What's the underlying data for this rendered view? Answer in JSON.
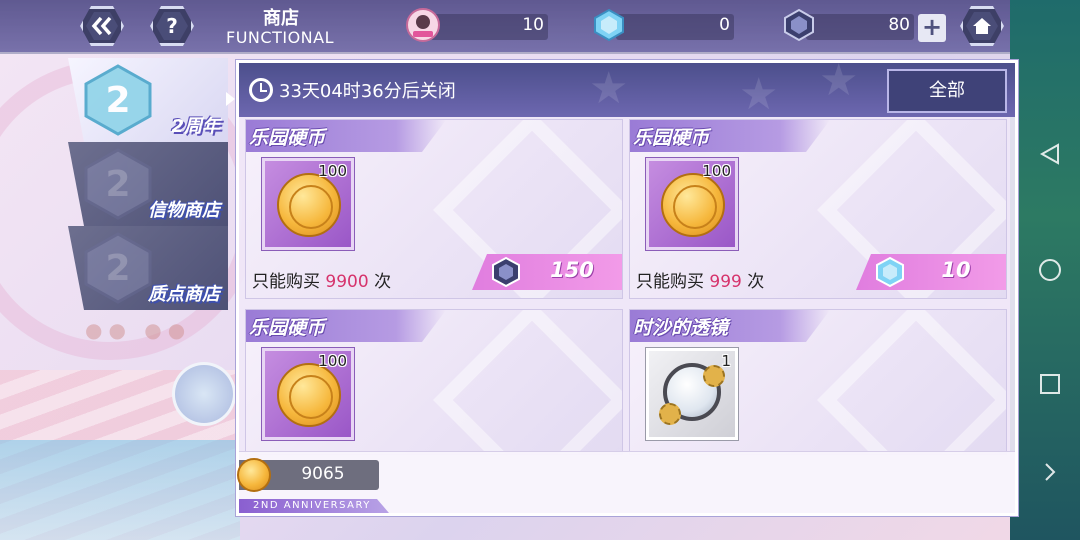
{
  "header": {
    "title": "商店",
    "subtitle": "FUNCTIONAL",
    "back_icon": "double-chevron-left-icon",
    "help_label": "?",
    "home_icon": "home-icon"
  },
  "currencies": [
    {
      "icon": "character-badge-icon",
      "value": "10"
    },
    {
      "icon": "blue-crystal-icon",
      "value": "0"
    },
    {
      "icon": "dark-gem-icon",
      "value": "80"
    }
  ],
  "currency_add_label": "+",
  "sidebar": {
    "tabs": [
      {
        "label": "2周年",
        "active": true
      },
      {
        "label": "信物商店",
        "active": false
      },
      {
        "label": "质点商店",
        "active": false
      }
    ]
  },
  "panel": {
    "timer_text": "33天04时36分后关闭",
    "filter_label": "全部"
  },
  "items": [
    {
      "name": "乐园硬币",
      "quantity": "100",
      "limit_prefix": "只能购买",
      "limit_count": "9900",
      "limit_suffix": "次",
      "price": "150",
      "price_currency": "dark-gem-icon",
      "icon": "gold-coin-icon"
    },
    {
      "name": "乐园硬币",
      "quantity": "100",
      "limit_prefix": "只能购买",
      "limit_count": "999",
      "limit_suffix": "次",
      "price": "10",
      "price_currency": "blue-crystal-icon",
      "icon": "gold-coin-icon"
    },
    {
      "name": "乐园硬币",
      "quantity": "100",
      "icon": "gold-coin-icon"
    },
    {
      "name": "时沙的透镜",
      "quantity": "1",
      "icon": "magnifying-lens-icon"
    }
  ],
  "footer": {
    "balance": "9065",
    "anniversary_text": "2ND ANNIVERSARY"
  },
  "colors": {
    "accent_purple": "#9a7bd6",
    "price_pink": "#e07ddf",
    "limit_red": "#d6336c",
    "header_dark": "#4c4f8c"
  }
}
